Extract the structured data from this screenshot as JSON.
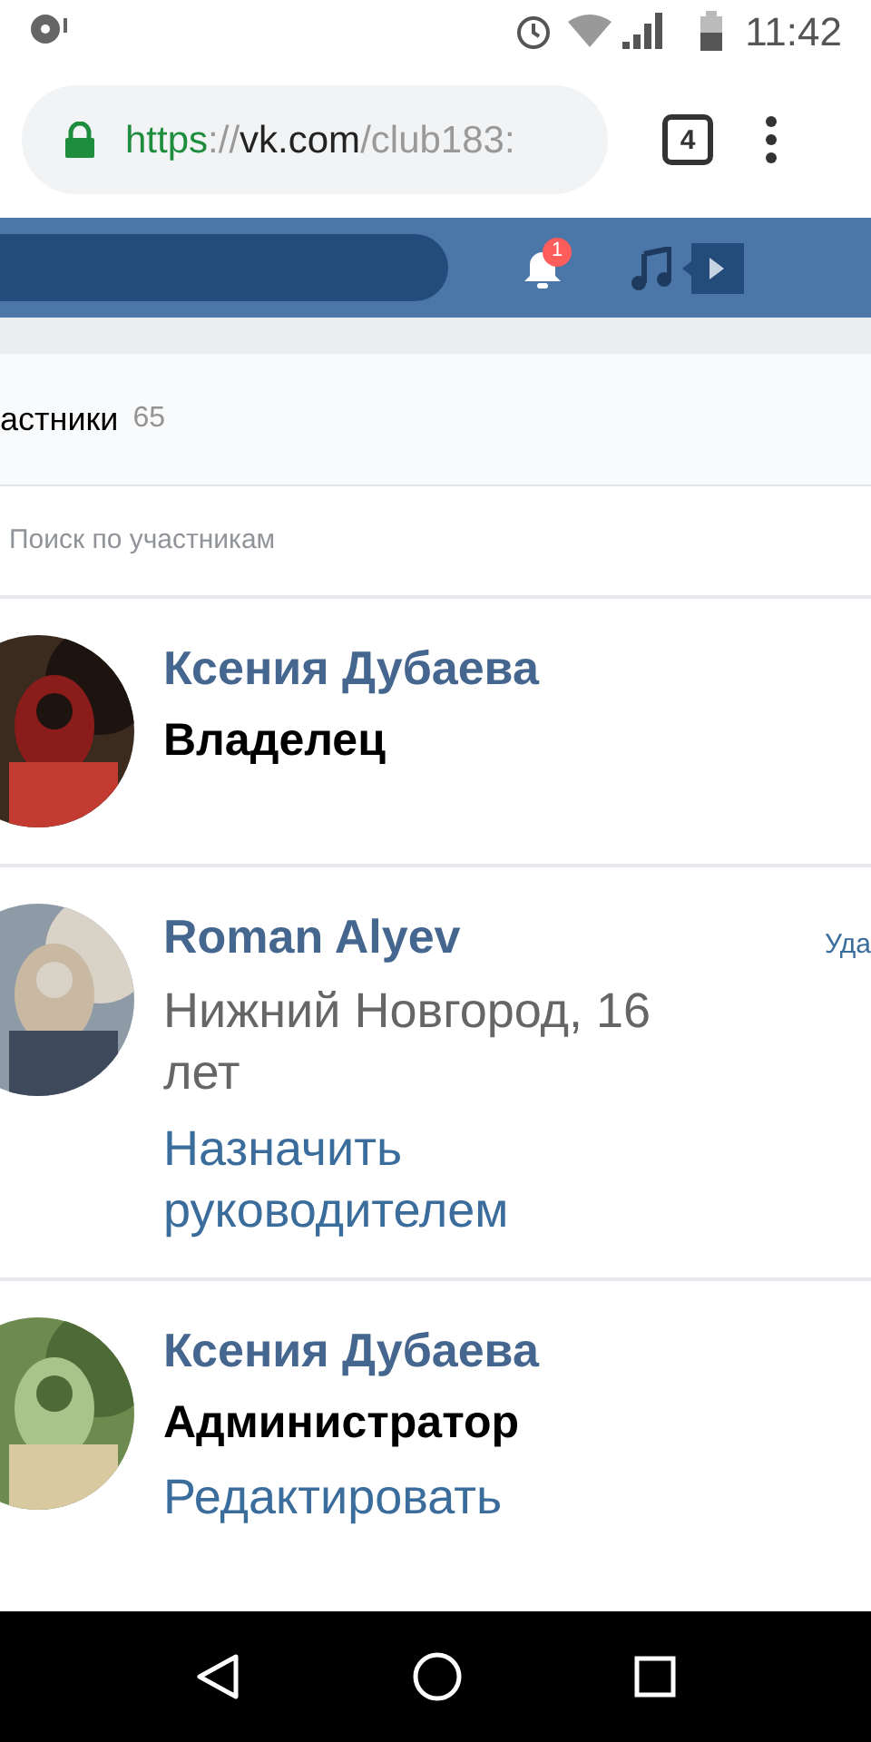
{
  "status_bar": {
    "time": "11:42"
  },
  "browser": {
    "url_scheme": "https",
    "url_separator": "://",
    "url_host": "vk.com",
    "url_path": "/club183",
    "url_tail": ":",
    "tab_count": "4"
  },
  "header": {
    "notification_count": "1"
  },
  "tab": {
    "label": "астники",
    "count": "65"
  },
  "search": {
    "placeholder": "Поиск по участникам"
  },
  "members": [
    {
      "name": "Ксения Дубаева",
      "avatar": {
        "kind": "picture"
      },
      "lines": [
        {
          "kind": "role",
          "text": "Владелец"
        }
      ]
    },
    {
      "name": "Roman Alyev",
      "avatar": {
        "kind": "picture"
      },
      "side_action": "Уда",
      "lines": [
        {
          "kind": "info",
          "text": "Нижний Новгород, 16 лет"
        },
        {
          "kind": "action",
          "text": "Назначить руководителем"
        }
      ]
    },
    {
      "name": "Ксения Дубаева",
      "avatar": {
        "kind": "picture"
      },
      "lines": [
        {
          "kind": "role",
          "text": "Администратор"
        },
        {
          "kind": "action",
          "text": "Редактировать"
        }
      ]
    }
  ]
}
